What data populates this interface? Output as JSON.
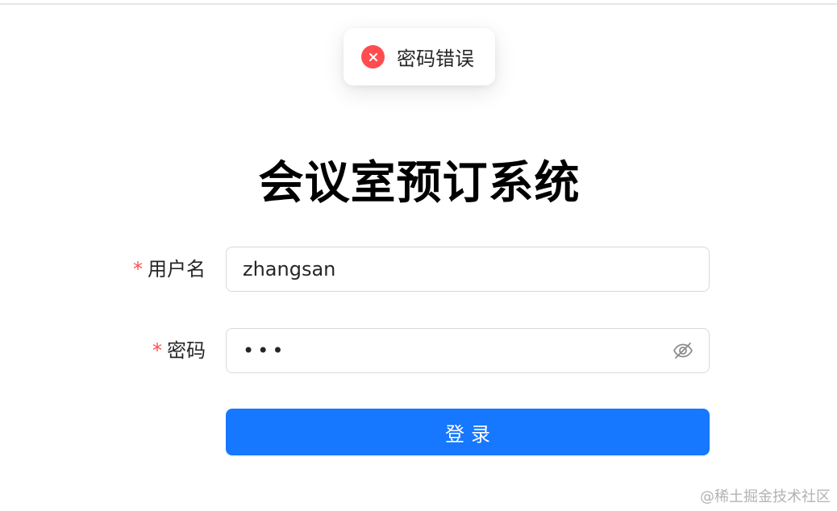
{
  "toast": {
    "message": "密码错误",
    "type": "error",
    "icon": "close-icon",
    "icon_color": "#ff4d4f"
  },
  "page": {
    "title": "会议室预订系统"
  },
  "form": {
    "required_mark": "*",
    "username": {
      "label": "用户名",
      "value": "zhangsan"
    },
    "password": {
      "label": "密码",
      "masked_value": "•••",
      "toggle_icon": "eye-invisible-icon"
    },
    "submit_label": "登录"
  },
  "watermark": "@稀土掘金技术社区",
  "colors": {
    "primary": "#1677ff",
    "error": "#ff4d4f",
    "border": "#d9d9d9",
    "text": "#262626"
  }
}
